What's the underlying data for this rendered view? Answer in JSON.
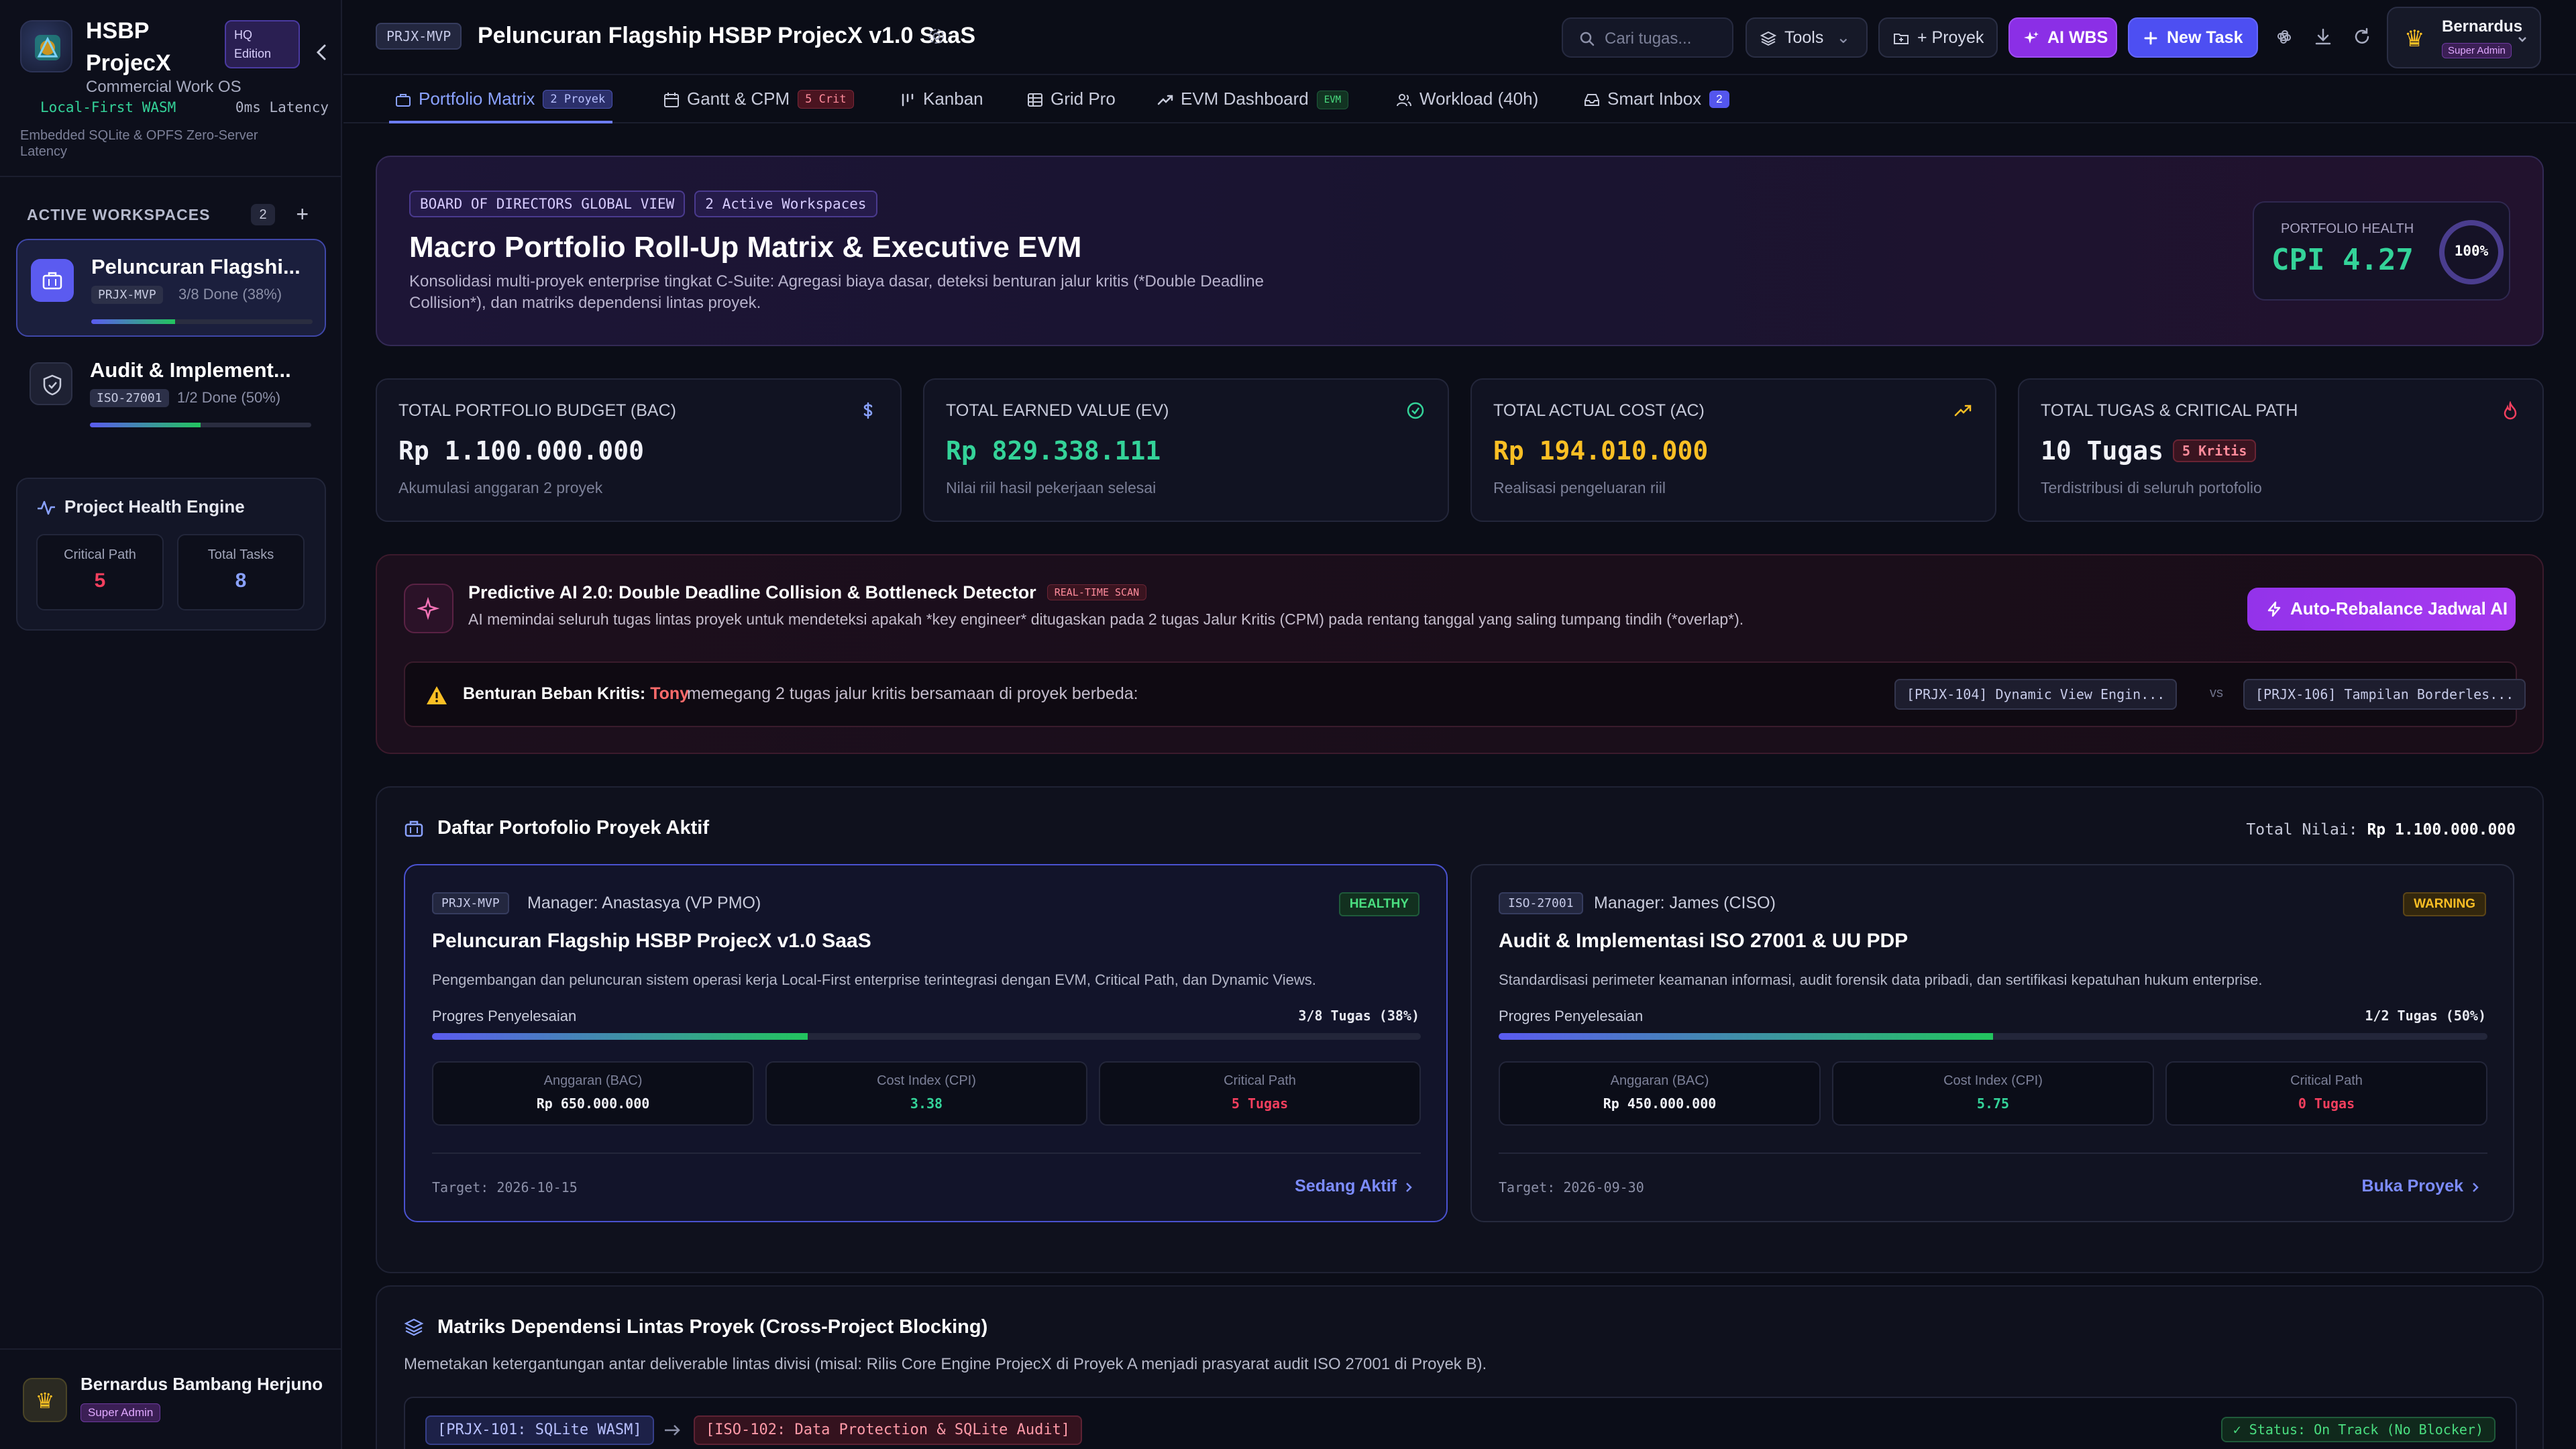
{
  "app": {
    "name": "HSBP ProjecX",
    "edition": "HQ Edition",
    "subtitle": "Commercial Work OS",
    "local_tag": "Local-First WASM",
    "latency": "0ms Latency",
    "local_sub": "Embedded SQLite & OPFS Zero-Server Latency"
  },
  "sidebar": {
    "workspaces_title": "ACTIVE WORKSPACES",
    "workspaces_count": "2",
    "workspaces": [
      {
        "name": "Peluncuran Flagshi...",
        "code": "PRJX-MVP",
        "done": "3/8 Done (38%)",
        "progress": 0.38
      },
      {
        "name": "Audit & Implement...",
        "code": "ISO-27001",
        "done": "1/2 Done (50%)",
        "progress": 0.5
      }
    ],
    "health": {
      "title": "Project Health Engine",
      "critical_label": "Critical Path",
      "critical_value": "5",
      "tasks_label": "Total Tasks",
      "tasks_value": "8"
    },
    "profile": {
      "name": "Bernardus Bambang Herjuno",
      "role": "Super Admin"
    }
  },
  "topbar": {
    "project_code": "PRJX-MVP",
    "title": "Peluncuran Flagship HSBP ProjecX v1.0 SaaS",
    "search_placeholder": "Cari tugas...",
    "tools_label": "Tools",
    "proyek_label": "+ Proyek",
    "ai_wbs_label": "AI WBS",
    "new_task_label": "New Task",
    "user_name": "Bernardus",
    "user_role": "Super Admin"
  },
  "tabs": [
    {
      "label": "Portfolio Matrix",
      "badge": "2 Proyek"
    },
    {
      "label": "Gantt & CPM",
      "badge": "5 Crit"
    },
    {
      "label": "Kanban"
    },
    {
      "label": "Grid Pro"
    },
    {
      "label": "EVM Dashboard",
      "badge": "EVM"
    },
    {
      "label": "Workload (40h)"
    },
    {
      "label": "Smart Inbox",
      "badge": "2"
    }
  ],
  "hero": {
    "tag1": "BOARD OF DIRECTORS GLOBAL VIEW",
    "tag2": "2 Active Workspaces",
    "title": "Macro Portfolio Roll-Up Matrix & Executive EVM",
    "desc": "Konsolidasi multi-proyek enterprise tingkat C-Suite: Agregasi biaya dasar, deteksi benturan jalur kritis (*Double Deadline Collision*), dan matriks dependensi lintas proyek.",
    "health_label": "PORTFOLIO HEALTH",
    "health_value": "CPI 4.27",
    "health_pct": "100%",
    "health_fraction": 1.0
  },
  "kpis": [
    {
      "label": "TOTAL PORTFOLIO BUDGET (BAC)",
      "value": "Rp 1.100.000.000",
      "sub": "Akumulasi anggaran 2 proyek",
      "color": "#f1f2f8",
      "icon": "dollar-icon"
    },
    {
      "label": "TOTAL EARNED VALUE (EV)",
      "value": "Rp 829.338.111",
      "sub": "Nilai riil hasil pekerjaan selesai",
      "color": "#34d399",
      "icon": "check-circle-icon"
    },
    {
      "label": "TOTAL ACTUAL COST (AC)",
      "value": "Rp 194.010.000",
      "sub": "Realisasi pengeluaran riil",
      "color": "#fbbf24",
      "icon": "trending-up-icon"
    },
    {
      "label": "TOTAL TUGAS & CRITICAL PATH",
      "value": "10 Tugas",
      "badge": "5 Kritis",
      "sub": "Terdistribusi di seluruh portofolio",
      "color": "#f1f2f8",
      "icon": "flame-icon"
    }
  ],
  "ai": {
    "title": "Predictive AI 2.0: Double Deadline Collision & Bottleneck Detector",
    "scan": "REAL-TIME SCAN",
    "desc": "AI memindai seluruh tugas lintas proyek untuk mendeteksi apakah *key engineer* ditugaskan pada 2 tugas Jalur Kritis (CPM) pada rentang tanggal yang saling tumpang tindih (*overlap*).",
    "button": "Auto-Rebalance Jadwal AI",
    "alert_lead": "Benturan Beban Kritis:",
    "alert_name": "Tony",
    "alert_text": "memegang 2 tugas jalur kritis bersamaan di proyek berbeda:",
    "chip1": "[PRJX-104] Dynamic View Engin...",
    "vs": "vs",
    "chip2": "[PRJX-106] Tampilan Borderles..."
  },
  "portfolio": {
    "title": "Daftar Portofolio Proyek Aktif",
    "total_label": "Total Nilai:",
    "total_value": "Rp 1.100.000.000",
    "projects": [
      {
        "code": "PRJX-MVP",
        "manager": "Manager: Anastasya (VP PMO)",
        "status": "HEALTHY",
        "title": "Peluncuran Flagship HSBP ProjecX v1.0 SaaS",
        "desc": "Pengembangan dan peluncuran sistem operasi kerja Local-First enterprise terintegrasi dengan EVM, Critical Path, dan Dynamic Views.",
        "progress_label": "Progres Penyelesaian",
        "progress_text": "3/8 Tugas (38%)",
        "progress": 0.38,
        "bac_label": "Anggaran (BAC)",
        "bac": "Rp 650.000.000",
        "cpi_label": "Cost Index (CPI)",
        "cpi": "3.38",
        "cp_label": "Critical Path",
        "cp": "5 Tugas",
        "target": "Target: 2026-10-15",
        "link": "Sedang Aktif"
      },
      {
        "code": "ISO-27001",
        "manager": "Manager: James (CISO)",
        "status": "WARNING",
        "title": "Audit & Implementasi ISO 27001 & UU PDP",
        "desc": "Standardisasi perimeter keamanan informasi, audit forensik data pribadi, dan sertifikasi kepatuhan hukum enterprise.",
        "progress_label": "Progres Penyelesaian",
        "progress_text": "1/2 Tugas (50%)",
        "progress": 0.5,
        "bac_label": "Anggaran (BAC)",
        "bac": "Rp 450.000.000",
        "cpi_label": "Cost Index (CPI)",
        "cpi": "5.75",
        "cp_label": "Critical Path",
        "cp": "0 Tugas",
        "target": "Target: 2026-09-30",
        "link": "Buka Proyek"
      }
    ]
  },
  "deps": {
    "title": "Matriks Dependensi Lintas Proyek (Cross-Project Blocking)",
    "desc": "Memetakan ketergantungan antar deliverable lintas divisi (misal: Rilis Core Engine ProjecX di Proyek A menjadi prasyarat audit ISO 27001 di Proyek B).",
    "from": "[PRJX-101: SQLite WASM]",
    "to": "[ISO-102: Data Protection & SQLite Audit]",
    "status": "✓ Status: On Track (No Blocker)"
  },
  "colors": {
    "accent": "#5b5bf0",
    "success": "#34d399",
    "warning": "#fbbf24",
    "danger": "#f43f5e",
    "violet": "#9333ea"
  }
}
